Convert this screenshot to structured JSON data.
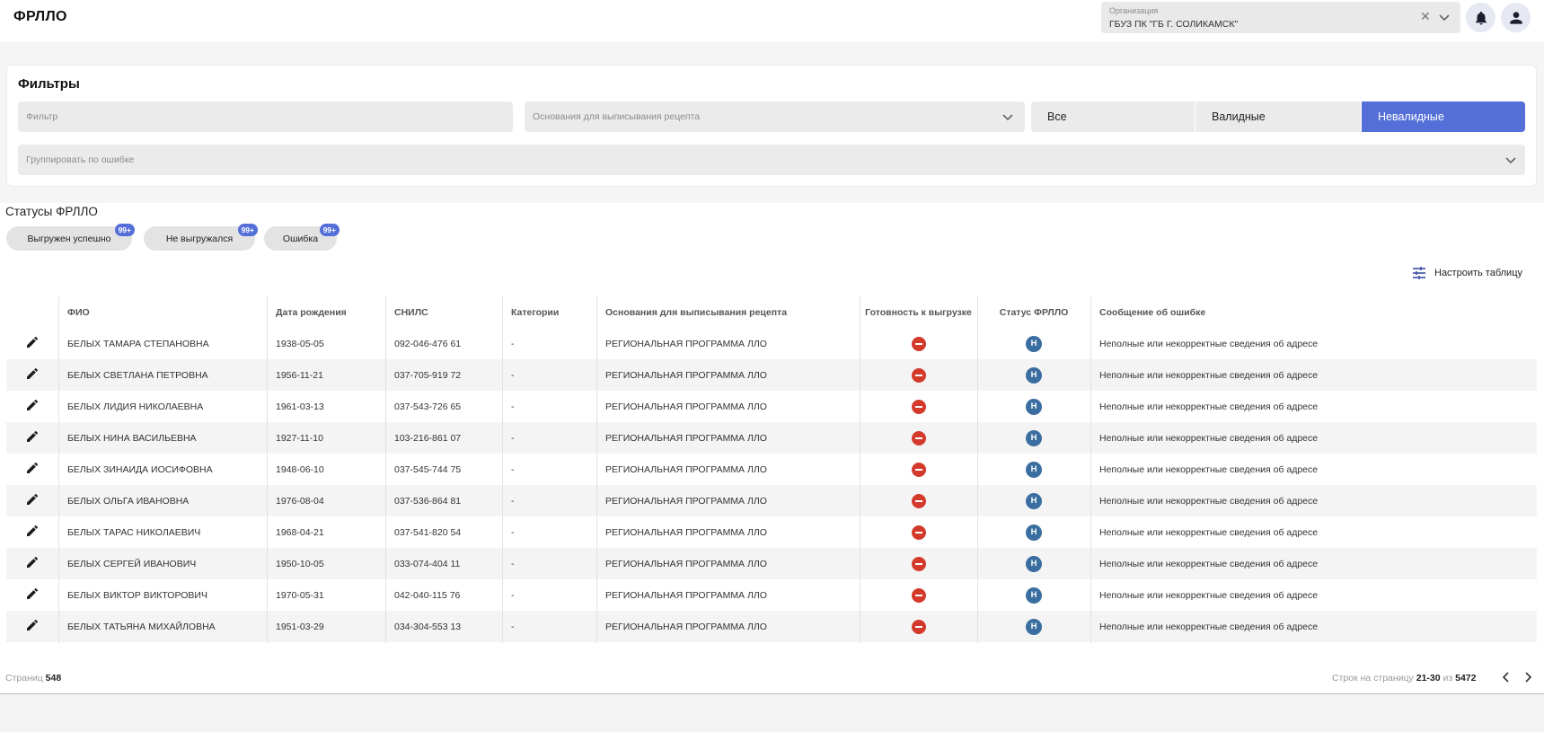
{
  "header": {
    "title": "ФРЛЛО",
    "org_label": "Организация",
    "org_value": "ГБУЗ ПК \"ГБ Г. СОЛИКАМСК\"",
    "clear_glyph": "✕"
  },
  "filters": {
    "title": "Фильтры",
    "filter_placeholder": "Фильтр",
    "reason_placeholder": "Основания для выписывания рецепта",
    "group_placeholder": "Группировать по ошибке",
    "segments": {
      "all": "Все",
      "valid": "Валидные",
      "invalid": "Невалидные",
      "active": "invalid"
    },
    "accent_color": "#5470d8"
  },
  "statuses": {
    "title": "Статусы ФРЛЛО",
    "chips": [
      {
        "label": "Выгружен успешно",
        "badge": "99+"
      },
      {
        "label": "Не выгружался",
        "badge": "99+"
      },
      {
        "label": "Ошибка",
        "badge": "99+"
      }
    ]
  },
  "toolbar": {
    "configure_label": "Настроить таблицу",
    "configure_icon": "sliders-icon"
  },
  "table": {
    "columns": {
      "fio": "ФИО",
      "birth": "Дата рождения",
      "snils": "СНИЛС",
      "categories": "Категории",
      "reason": "Основания для выписывания рецепта",
      "ready": "Готовность к выгрузке",
      "status": "Статус ФРЛЛО",
      "error": "Сообщение об ошибке"
    },
    "rows": [
      {
        "fio": "БЕЛЫХ ТАМАРА СТЕПАНОВНА",
        "birth": "1938-05-05",
        "snils": "092-046-476 61",
        "categories": "-",
        "reason": "РЕГИОНАЛЬНАЯ ПРОГРАММА ЛЛО",
        "status": "Н",
        "error": "Неполные или некорректные сведения об адресе"
      },
      {
        "fio": "БЕЛЫХ СВЕТЛАНА ПЕТРОВНА",
        "birth": "1956-11-21",
        "snils": "037-705-919 72",
        "categories": "-",
        "reason": "РЕГИОНАЛЬНАЯ ПРОГРАММА ЛЛО",
        "status": "Н",
        "error": "Неполные или некорректные сведения об адресе"
      },
      {
        "fio": "БЕЛЫХ ЛИДИЯ НИКОЛАЕВНА",
        "birth": "1961-03-13",
        "snils": "037-543-726 65",
        "categories": "-",
        "reason": "РЕГИОНАЛЬНАЯ ПРОГРАММА ЛЛО",
        "status": "Н",
        "error": "Неполные или некорректные сведения об адресе"
      },
      {
        "fio": "БЕЛЫХ НИНА ВАСИЛЬЕВНА",
        "birth": "1927-11-10",
        "snils": "103-216-861 07",
        "categories": "-",
        "reason": "РЕГИОНАЛЬНАЯ ПРОГРАММА ЛЛО",
        "status": "Н",
        "error": "Неполные или некорректные сведения об адресе"
      },
      {
        "fio": "БЕЛЫХ ЗИНАИДА ИОСИФОВНА",
        "birth": "1948-06-10",
        "snils": "037-545-744 75",
        "categories": "-",
        "reason": "РЕГИОНАЛЬНАЯ ПРОГРАММА ЛЛО",
        "status": "Н",
        "error": "Неполные или некорректные сведения об адресе"
      },
      {
        "fio": "БЕЛЫХ ОЛЬГА ИВАНОВНА",
        "birth": "1976-08-04",
        "snils": "037-536-864 81",
        "categories": "-",
        "reason": "РЕГИОНАЛЬНАЯ ПРОГРАММА ЛЛО",
        "status": "Н",
        "error": "Неполные или некорректные сведения об адресе"
      },
      {
        "fio": "БЕЛЫХ ТАРАС НИКОЛАЕВИЧ",
        "birth": "1968-04-21",
        "snils": "037-541-820 54",
        "categories": "-",
        "reason": "РЕГИОНАЛЬНАЯ ПРОГРАММА ЛЛО",
        "status": "Н",
        "error": "Неполные или некорректные сведения об адресе"
      },
      {
        "fio": "БЕЛЫХ СЕРГЕЙ ИВАНОВИЧ",
        "birth": "1950-10-05",
        "snils": "033-074-404 11",
        "categories": "-",
        "reason": "РЕГИОНАЛЬНАЯ ПРОГРАММА ЛЛО",
        "status": "Н",
        "error": "Неполные или некорректные сведения об адресе"
      },
      {
        "fio": "БЕЛЫХ ВИКТОР ВИКТОРОВИЧ",
        "birth": "1970-05-31",
        "snils": "042-040-115 76",
        "categories": "-",
        "reason": "РЕГИОНАЛЬНАЯ ПРОГРАММА ЛЛО",
        "status": "Н",
        "error": "Неполные или некорректные сведения об адресе"
      },
      {
        "fio": "БЕЛЫХ ТАТЬЯНА МИХАЙЛОВНА",
        "birth": "1951-03-29",
        "snils": "034-304-553 13",
        "categories": "-",
        "reason": "РЕГИОНАЛЬНАЯ ПРОГРАММА ЛЛО",
        "status": "Н",
        "error": "Неполные или некорректные сведения об адресе"
      }
    ],
    "not_ready_color": "#d33a2c",
    "status_badge_color": "#3b6ea0"
  },
  "pagination": {
    "pages_label": "Страниц",
    "pages_count": "548",
    "rows_label": "Строк на страницу",
    "range": "21-30",
    "of_label": "из",
    "total": "5472"
  }
}
